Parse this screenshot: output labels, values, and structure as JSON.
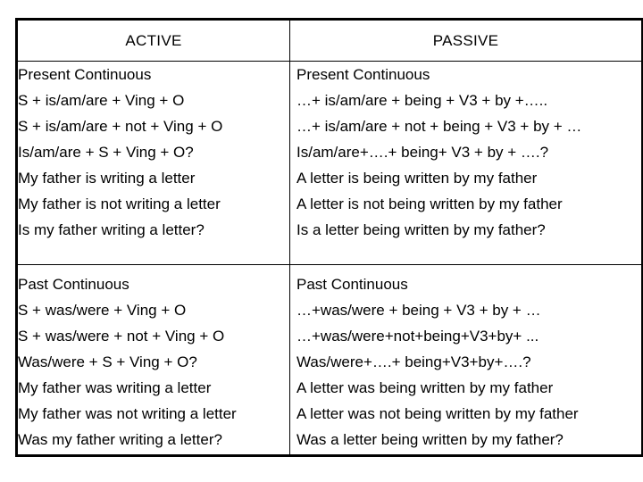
{
  "table": {
    "headers": [
      {
        "label": "ACTIVE"
      },
      {
        "label": "PASSIVE"
      }
    ],
    "rows": [
      {
        "id": "present-continuous",
        "active": {
          "lines": [
            "Present Continuous",
            "S + is/am/are + Ving + O",
            "S + is/am/are + not + Ving + O",
            "Is/am/are + S + Ving + O?",
            "My father is writing a letter",
            "My father is not writing a letter",
            "Is my father writing a letter?"
          ]
        },
        "passive": {
          "lines": [
            "Present Continuous",
            "…+ is/am/are + being + V3 + by +…..",
            "…+ is/am/are + not + being + V3 + by + …",
            "Is/am/are+….+ being+ V3 + by + ….?",
            "A letter is being written by my father",
            "A letter is not being written by my father",
            "Is a letter being written by my father?"
          ]
        }
      },
      {
        "id": "past-continuous",
        "active": {
          "lines": [
            "Past Continuous",
            "S + was/were + Ving + O",
            "S + was/were + not + Ving + O",
            "Was/were + S + Ving + O?",
            "My father was writing a letter",
            "My father was not writing a letter",
            "Was my father writing a letter?"
          ]
        },
        "passive": {
          "lines": [
            "Past Continuous",
            "…+was/were + being + V3 + by + …",
            "…+was/were+not+being+V3+by+ ...",
            "Was/were+….+ being+V3+by+….?",
            "A letter was being written by my father",
            "A letter was not being written by my father",
            "Was a letter being written by my father?"
          ]
        }
      }
    ]
  },
  "colors": {
    "border": "#000000",
    "text": "#000000",
    "background": "#ffffff"
  }
}
